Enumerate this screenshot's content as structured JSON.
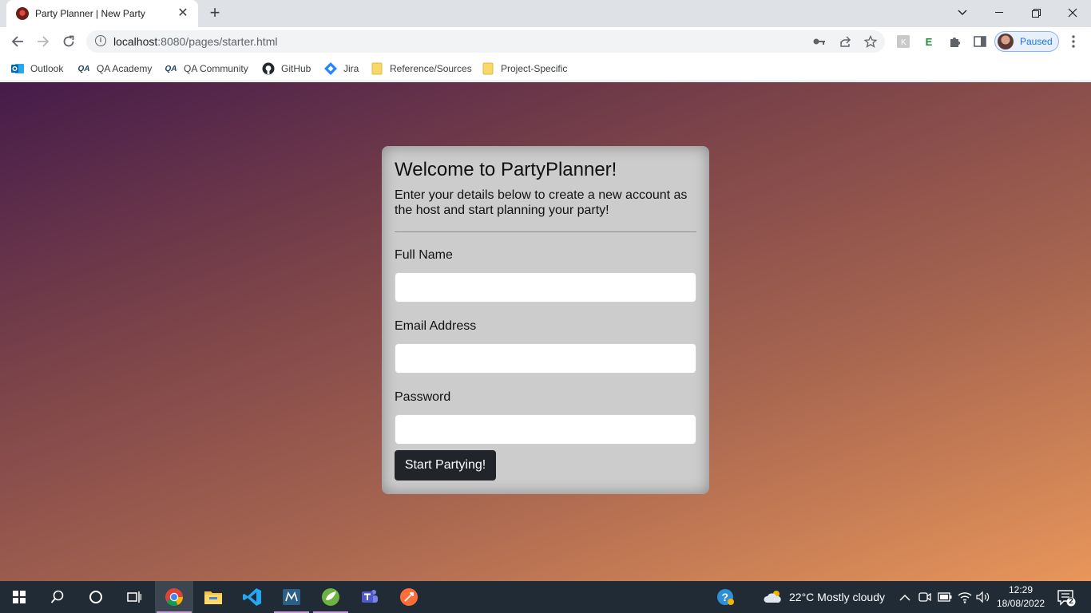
{
  "browser": {
    "tab_title": "Party Planner | New Party",
    "url_host": "localhost",
    "url_rest": ":8080/pages/starter.html",
    "profile_label": "Paused",
    "bookmarks": [
      {
        "label": "Outlook",
        "icon": "outlook-icon",
        "color": "#0364b8"
      },
      {
        "label": "QA Academy",
        "icon": "qa-icon",
        "color": "#1d3e57"
      },
      {
        "label": "QA Community",
        "icon": "qa-icon",
        "color": "#1d3e57"
      },
      {
        "label": "GitHub",
        "icon": "github-icon",
        "color": "#24292f"
      },
      {
        "label": "Jira",
        "icon": "jira-icon",
        "color": "#2684ff"
      },
      {
        "label": "Reference/Sources",
        "icon": "folder-icon",
        "color": "#f9d86a"
      },
      {
        "label": "Project-Specific",
        "icon": "folder-icon",
        "color": "#f9d86a"
      }
    ]
  },
  "form": {
    "title": "Welcome to PartyPlanner!",
    "description": "Enter your details below to create a new account as the host and start planning your party!",
    "fields": [
      {
        "label": "Full Name",
        "value": ""
      },
      {
        "label": "Email Address",
        "value": ""
      },
      {
        "label": "Password",
        "value": ""
      }
    ],
    "submit_label": "Start Partying!",
    "button_color": "#212529",
    "card_color": "#cccccc"
  },
  "taskbar": {
    "weather": "22°C  Mostly cloudy",
    "time": "12:29",
    "date": "18/08/2022",
    "notification_count": "2",
    "apps": [
      "start-icon",
      "search-icon",
      "cortana-icon",
      "task-view-icon",
      "chrome-icon",
      "file-explorer-icon",
      "vscode-icon",
      "mysql-workbench-icon",
      "spring-tools-icon",
      "teams-icon",
      "postman-icon"
    ]
  }
}
